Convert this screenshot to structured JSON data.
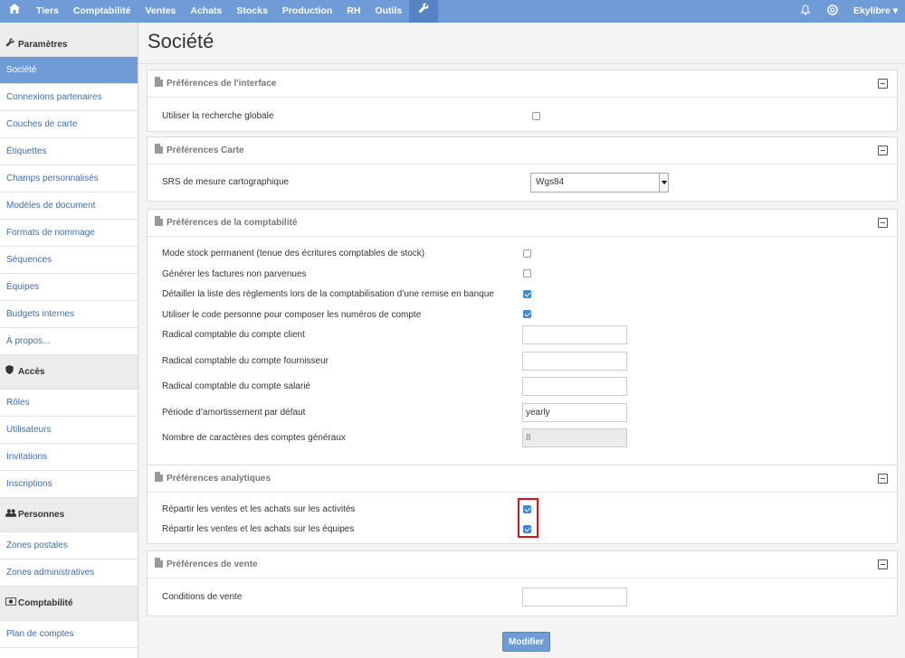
{
  "topnav": {
    "items": [
      "Tiers",
      "Comptabilité",
      "Ventes",
      "Achats",
      "Stocks",
      "Production",
      "RH",
      "Outils"
    ],
    "user": "Ekylibre",
    "home_icon": "home-icon",
    "tools_icon": "wrench-icon"
  },
  "sidebar": {
    "sections": [
      {
        "title": "Paramètres",
        "icon": "wrench-icon",
        "items": [
          "Société",
          "Connexions partenaires",
          "Couches de carte",
          "Étiquettes",
          "Champs personnalisés",
          "Modèles de document",
          "Formats de nommage",
          "Séquences",
          "Équipes",
          "Budgets internes",
          "À propos..."
        ]
      },
      {
        "title": "Accès",
        "icon": "shield-icon",
        "items": [
          "Rôles",
          "Utilisateurs",
          "Invitations",
          "Inscriptions"
        ]
      },
      {
        "title": "Personnes",
        "icon": "people-icon",
        "items": [
          "Zones postales",
          "Zones administratives"
        ]
      },
      {
        "title": "Comptabilité",
        "icon": "money-icon",
        "items": [
          "Plan de comptes"
        ]
      }
    ],
    "active_item": "Société"
  },
  "page": {
    "title": "Société",
    "submit_label": "Modifier"
  },
  "panels": {
    "interface": {
      "title": "Préférences de l'interface",
      "label_global_search": "Utiliser la recherche globale",
      "global_search_checked": false
    },
    "map": {
      "title": "Préférences Carte",
      "label_srs": "SRS de mesure cartographique",
      "srs_value": "Wgs84"
    },
    "accounting": {
      "title": "Préférences de la comptabilité",
      "labels": [
        "Mode stock permanent (tenue des écritures comptables de stock)",
        "Générer les factures non parvenues",
        "Détailler la liste des règlements lors de la comptabilisation d’une remise en banque",
        "Utiliser le code personne pour composer les numéros de compte",
        "Radical comptable du compte client",
        "Radical comptable du compte fournisseur",
        "Radical comptable du compte salarié",
        "Période d’amortissement par défaut",
        "Nombre de caractères des comptes généraux"
      ],
      "checks": [
        false,
        false,
        true,
        true
      ],
      "client_radical": "",
      "supplier_radical": "",
      "employee_radical": "",
      "depreciation_period": "yearly",
      "account_chars": "8"
    },
    "analytics": {
      "title": "Préférences analytiques",
      "labels": [
        "Répartir les ventes et les achats sur les activités",
        "Répartir les ventes et les achats sur les équipes"
      ],
      "checks": [
        true,
        true
      ]
    },
    "sale": {
      "title": "Préférences de vente",
      "label_conditions": "Conditions de vente",
      "conditions_value": ""
    }
  },
  "colors": {
    "accent": "#6f9bd6",
    "highlight": "#e0101a",
    "checkbox": "#3b87d9"
  }
}
